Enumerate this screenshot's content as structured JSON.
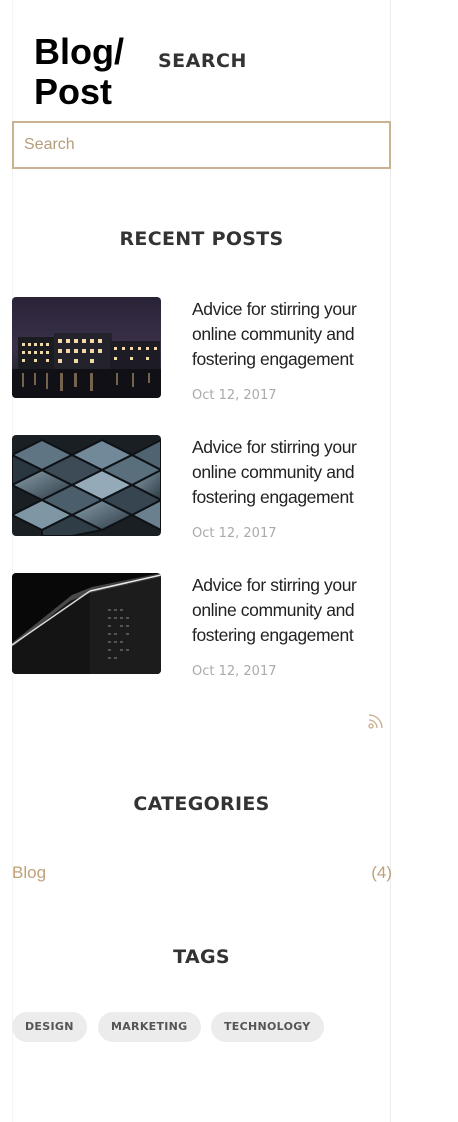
{
  "header": {
    "title": "Blog/\nPost",
    "title_line1": "Blog/",
    "title_line2": "Post"
  },
  "search": {
    "heading": "SEARCH",
    "placeholder": "Search",
    "value": ""
  },
  "recent_posts": {
    "heading": "RECENT POSTS",
    "items": [
      {
        "title": "Advice for stirring your online community and fostering engagement",
        "date": "Oct 12, 2017",
        "image": "night-city-buildings-photo"
      },
      {
        "title": "Advice for stirring your online community and fostering engagement",
        "date": "Oct 12, 2017",
        "image": "glass-cubes-photo"
      },
      {
        "title": "Advice for stirring your online community and fostering engagement",
        "date": "Oct 12, 2017",
        "image": "dark-skyscraper-photo"
      }
    ],
    "rss_icon": "rss-icon"
  },
  "categories": {
    "heading": "CATEGORIES",
    "items": [
      {
        "name": "Blog",
        "count": "(4)"
      }
    ]
  },
  "tags": {
    "heading": "TAGS",
    "items": [
      "DESIGN",
      "MARKETING",
      "TECHNOLOGY"
    ]
  },
  "colors": {
    "accent": "#c0a07a",
    "search_border": "#c9b28f",
    "heading": "#333333",
    "date": "#aaaaaa",
    "tag_bg": "#ececec"
  }
}
